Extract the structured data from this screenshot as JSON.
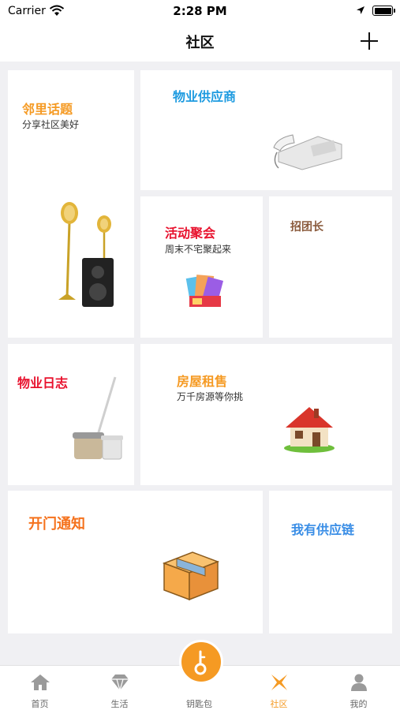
{
  "status_bar": {
    "carrier": "Carrier",
    "time": "2:28 PM"
  },
  "nav": {
    "title": "社区"
  },
  "cards": {
    "neighbor": {
      "title": "邻里话题",
      "subtitle": "分享社区美好",
      "color": "#f59a23"
    },
    "supplier": {
      "title": "物业供应商",
      "color": "#1e9be0"
    },
    "activity": {
      "title": "活动聚会",
      "subtitle": "周末不宅聚起来",
      "color": "#e8112d"
    },
    "leader": {
      "title": "招团长",
      "color": "#8a5a3c"
    },
    "log": {
      "title": "物业日志",
      "color": "#e8112d"
    },
    "rent": {
      "title": "房屋租售",
      "subtitle": "万千房源等你挑",
      "color": "#f59a23"
    },
    "door": {
      "title": "开门通知",
      "color": "#f5721d"
    },
    "supply": {
      "title": "我有供应链",
      "color": "#3a8ee6"
    }
  },
  "tabs": [
    {
      "label": "首页",
      "icon": "home-icon"
    },
    {
      "label": "生活",
      "icon": "diamond-icon"
    },
    {
      "label": "钥匙包",
      "icon": "key-icon"
    },
    {
      "label": "社区",
      "icon": "community-icon",
      "active": true
    },
    {
      "label": "我的",
      "icon": "person-icon"
    }
  ],
  "colors": {
    "accent": "#f59a23",
    "tab_inactive": "#999999",
    "background": "#f0f0f3"
  }
}
